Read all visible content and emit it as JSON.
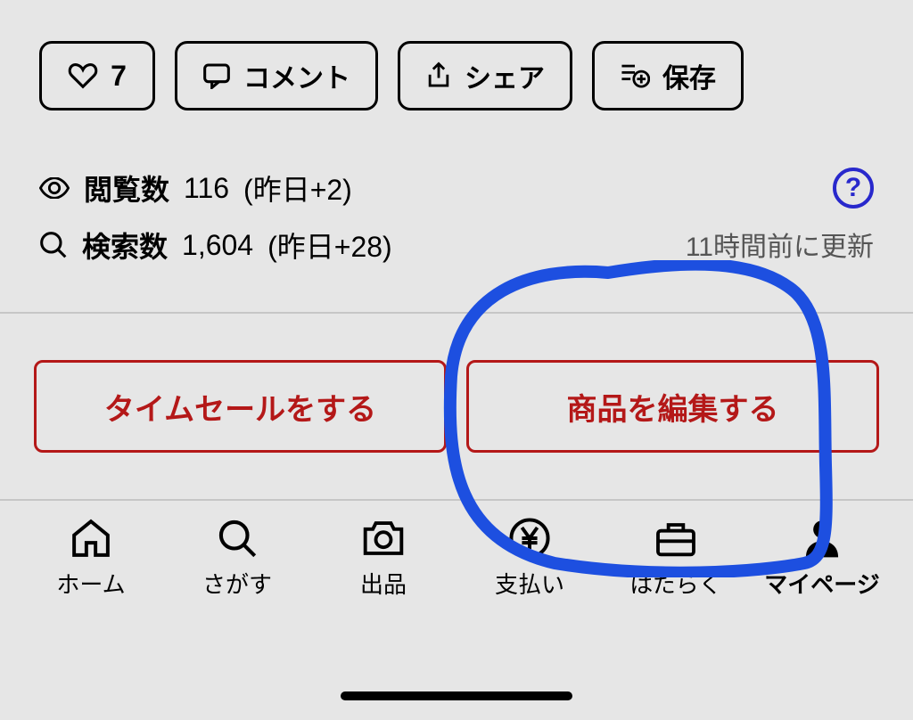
{
  "actions": {
    "like_count": "7",
    "comment_label": "コメント",
    "share_label": "シェア",
    "save_label": "保存"
  },
  "stats": {
    "views_label": "閲覧数",
    "views_value": "116",
    "views_change": "(昨日+2)",
    "searches_label": "検索数",
    "searches_value": "1,604",
    "searches_change": "(昨日+28)",
    "update_text": "11時間前に更新",
    "help_symbol": "?"
  },
  "primary": {
    "time_sale_label": "タイムセールをする",
    "edit_label": "商品を編集する"
  },
  "nav": {
    "home": "ホーム",
    "search": "さがす",
    "sell": "出品",
    "pay": "支払い",
    "work": "はたらく",
    "mypage": "マイページ"
  }
}
